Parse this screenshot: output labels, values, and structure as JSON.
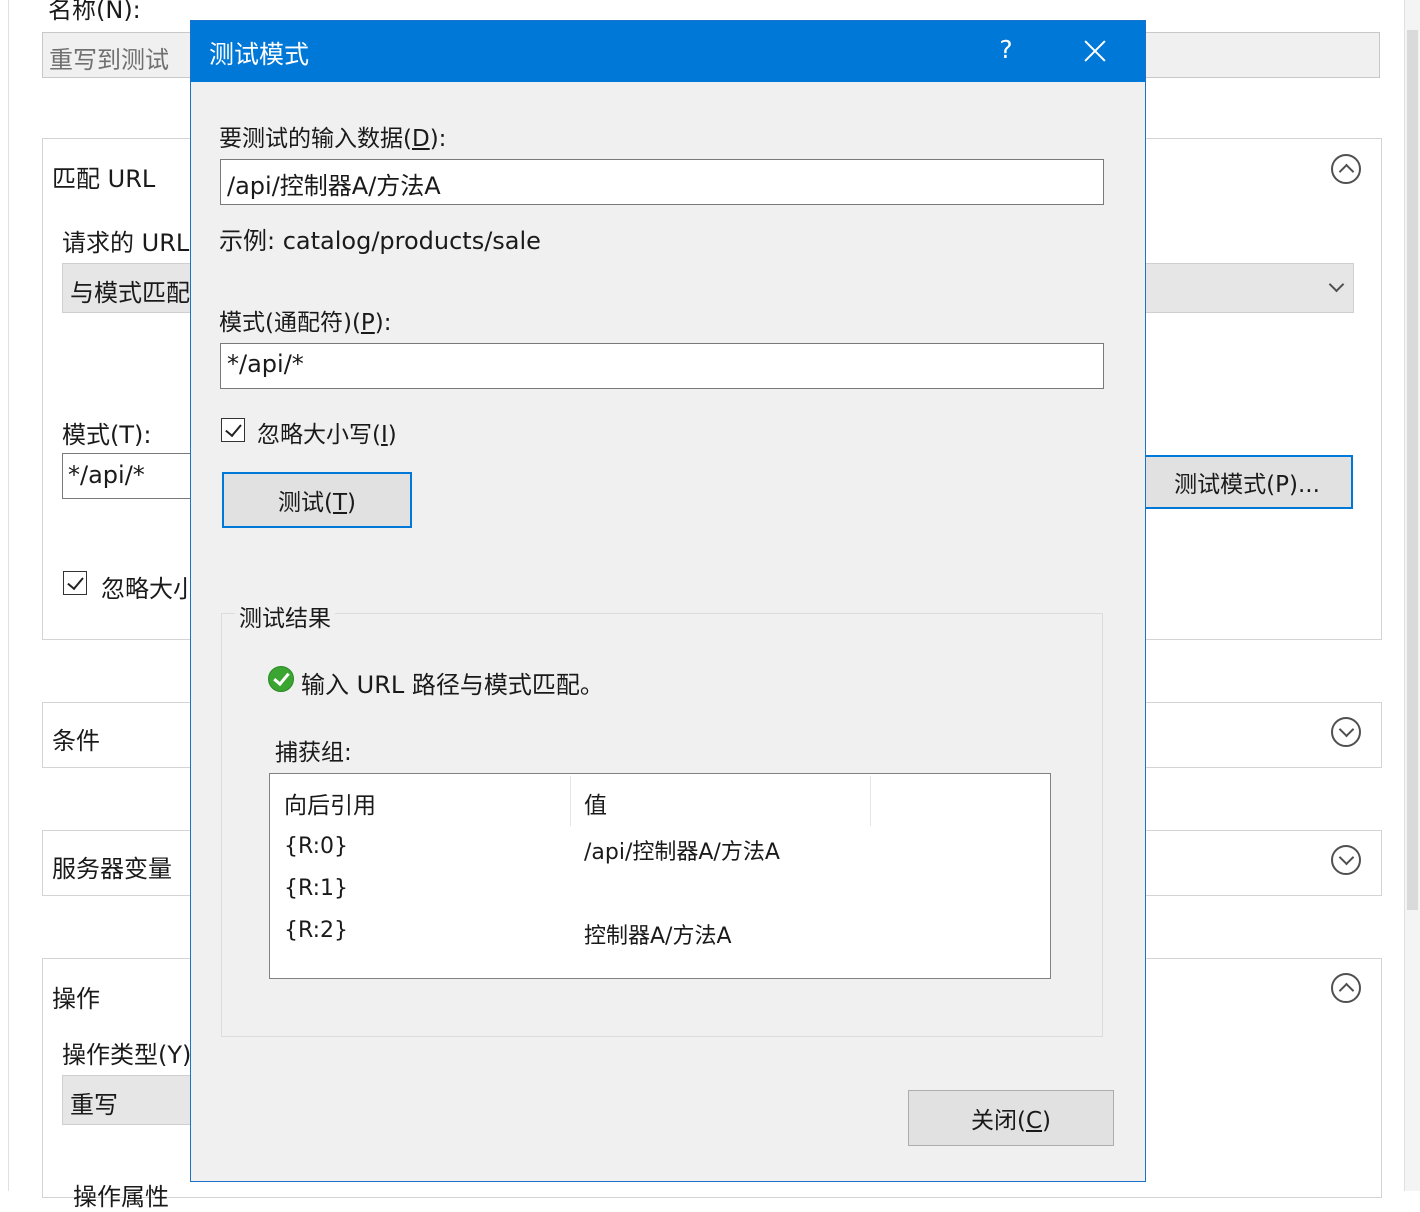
{
  "background": {
    "name_label": "名称(N):",
    "name_value": "重写到测试",
    "match_url_title": "匹配 URL",
    "requested_url_label": "请求的 URL",
    "requested_url_value": "与模式匹配",
    "pattern_label": "模式(T):",
    "pattern_value": "*/api/*",
    "ignore_case_label": "忽略大小",
    "test_pattern_button": "测试模式(P)...",
    "conditions_title": "条件",
    "server_vars_title": "服务器变量",
    "action_title": "操作",
    "action_type_label": "操作类型(Y)",
    "action_type_value": "重写",
    "action_props_label": "操作属性"
  },
  "dialog": {
    "title": "测试模式",
    "help_glyph": "?",
    "input_label_pre": "要测试的输入数据(",
    "input_label_key": "D",
    "input_label_post": "):",
    "input_value": "/api/控制器A/方法A",
    "example_text": "示例: catalog/products/sale",
    "pattern_label_pre": "模式(通配符)(",
    "pattern_label_key": "P",
    "pattern_label_post": "):",
    "pattern_value": "*/api/*",
    "ignore_case_pre": "忽略大小写(",
    "ignore_case_key": "I",
    "ignore_case_post": ")",
    "test_button_pre": "测试(",
    "test_button_key": "T",
    "test_button_post": ")",
    "results_title": "测试结果",
    "result_message": "输入 URL 路径与模式匹配。",
    "capture_label": "捕获组:",
    "columns": [
      "向后引用",
      "值"
    ],
    "rows": [
      {
        "ref": "{R:0}",
        "value": "/api/控制器A/方法A"
      },
      {
        "ref": "{R:1}",
        "value": ""
      },
      {
        "ref": "{R:2}",
        "value": "控制器A/方法A"
      }
    ],
    "close_button_pre": "关闭(",
    "close_button_key": "C",
    "close_button_post": ")"
  },
  "colors": {
    "titlebar": "#0078d7",
    "dialog_bg": "#f0f0f0",
    "success": "#3aa531"
  }
}
